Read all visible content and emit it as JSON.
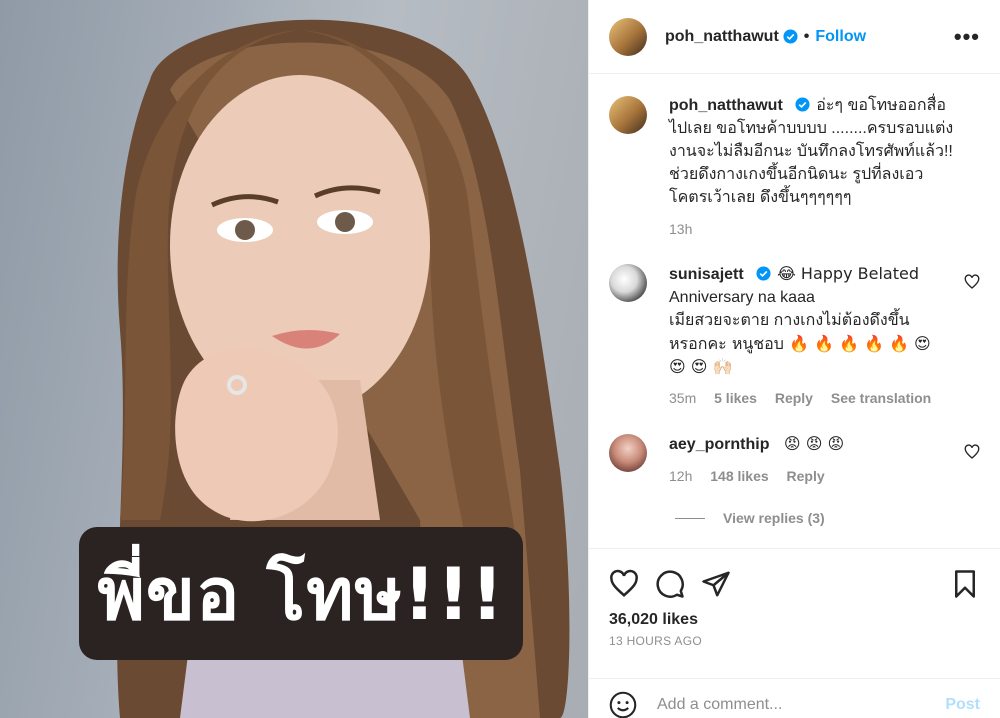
{
  "post": {
    "overlay_text": "พี่ขอ โทษ!!!",
    "author": "poh_natthawut",
    "follow_label": "Follow",
    "dot": "•",
    "more": "•••",
    "caption_lines": [
      "อ่ะๆ ขอโทษออกสื่อ",
      "ไปเลย ขอโทษค้าบบบบ ........ครบรอบแต่ง",
      "งานจะไม่ลืมอีกนะ บันทึกลงโทรศัพท์แล้ว!!",
      "ช่วยดึงกางเกงขึ้นอีกนิดนะ รูปที่ลงเอว",
      "โคตรเว้าเลย ดึงขึ้นๆๆๆๆๆๆ"
    ],
    "caption_time": "13h",
    "likes": "36,020 likes",
    "time_ago": "13 HOURS AGO",
    "add_comment_placeholder": "Add a comment...",
    "post_label": "Post"
  },
  "comments": [
    {
      "user": "sunisajett",
      "lines": [
        "😂 Happy Belated",
        "Anniversary na kaaa",
        "เมียสวยจะตาย กางเกงไม่ต้องดึงขึ้น",
        "หรอกคะ หนูชอบ 🔥 🔥 🔥 🔥 🔥 😍",
        "😍 😍 🙌🏻"
      ],
      "time": "35m",
      "likes": "5 likes",
      "reply": "Reply",
      "translate": "See translation"
    },
    {
      "user": "aey_pornthip",
      "text": "😡 😡 😡",
      "time": "12h",
      "likes": "148 likes",
      "reply": "Reply",
      "view_replies": "View replies (3)"
    }
  ],
  "colors": {
    "accent": "#0095f6",
    "muted": "#8e8e8e",
    "text": "#262626",
    "overlay_bg": "#2b2322"
  },
  "icons": [
    "verified-badge-icon",
    "more-options-icon",
    "heart-icon",
    "comment-icon",
    "share-icon",
    "bookmark-icon",
    "emoji-icon"
  ]
}
